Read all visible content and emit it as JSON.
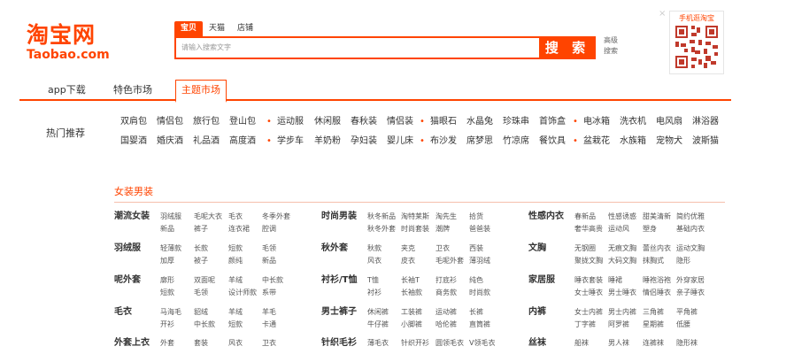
{
  "logo": {
    "cn": "淘宝网",
    "en": "Taobao.com"
  },
  "search": {
    "tabs": [
      "宝贝",
      "天猫",
      "店铺"
    ],
    "placeholder": "请输入搜索文字",
    "button": "搜 索",
    "advanced": [
      "高级",
      "搜索"
    ]
  },
  "qr": {
    "label": "手机逛淘宝",
    "close": "×"
  },
  "nav": {
    "items": [
      "app下载",
      "特色市场",
      "主题市场"
    ]
  },
  "hot": {
    "title": "热门推荐",
    "row1": [
      "双肩包",
      "情侣包",
      "旅行包",
      "登山包",
      "运动服",
      "休闲服",
      "春秋装",
      "情侣装",
      "猫眼石",
      "水晶兔",
      "珍珠串",
      "首饰盒",
      "电冰箱",
      "洗衣机",
      "电风扇",
      "淋浴器"
    ],
    "row2": [
      "国婴酒",
      "婚庆酒",
      "礼品酒",
      "高度酒",
      "学步车",
      "羊奶粉",
      "孕妇装",
      "婴儿床",
      "布沙发",
      "席梦思",
      "竹凉席",
      "餐饮具",
      "盆栽花",
      "水族箱",
      "宠物犬",
      "波斯猫"
    ]
  },
  "section": {
    "title": "女装男装",
    "columns": [
      [
        {
          "name": "潮流女装",
          "items": [
            "羽绒服",
            "毛呢大衣",
            "毛衣",
            "冬季外套",
            "新品",
            "裤子",
            "连衣裙",
            "腔调"
          ]
        },
        {
          "name": "羽绒服",
          "items": [
            "轻薄款",
            "长款",
            "短款",
            "毛领",
            "加厚",
            "被子",
            "颜纯",
            "新品"
          ]
        },
        {
          "name": "呢外套",
          "items": [
            "廓形",
            "双面呢",
            "羊绒",
            "中长款",
            "短款",
            "毛领",
            "设计师款",
            "系带"
          ]
        },
        {
          "name": "毛衣",
          "items": [
            "马海毛",
            "貂绒",
            "羊绒",
            "羊毛",
            "开衫",
            "中长款",
            "短款",
            "卡通"
          ]
        },
        {
          "name": "外套上衣",
          "items": [
            "外套",
            "套装",
            "风衣",
            "卫衣"
          ]
        }
      ],
      [
        {
          "name": "时尚男装",
          "items": [
            "秋冬新品",
            "淘特莱斯",
            "淘先生",
            "拾货",
            "秋冬外套",
            "时尚套装",
            "潮牌",
            "爸爸装"
          ]
        },
        {
          "name": "秋外套",
          "items": [
            "秋款",
            "夹克",
            "卫衣",
            "西装",
            "风衣",
            "皮衣",
            "毛呢外套",
            "薄羽绒"
          ]
        },
        {
          "name": "衬衫/T恤",
          "items": [
            "T恤",
            "长袖T",
            "打底衫",
            "纯色",
            "衬衫",
            "长袖款",
            "商务款",
            "时尚款"
          ]
        },
        {
          "name": "男士裤子",
          "items": [
            "休闲裤",
            "工装裤",
            "运动裤",
            "长裤",
            "牛仔裤",
            "小脚裤",
            "哈伦裤",
            "直筒裤"
          ]
        },
        {
          "name": "针织毛衫",
          "items": [
            "薄毛衣",
            "针织开衫",
            "圆领毛衣",
            "V领毛衣"
          ]
        }
      ],
      [
        {
          "name": "性感内衣",
          "items": [
            "春新品",
            "性感诱惑",
            "甜美清新",
            "简约优雅",
            "奢华高贵",
            "运动风",
            "塑身",
            "基础内衣"
          ]
        },
        {
          "name": "文胸",
          "items": [
            "无钢圈",
            "无痕文胸",
            "蕾丝内衣",
            "运动文胸",
            "聚拢文胸",
            "大码文胸",
            "抹胸式",
            "隐形"
          ]
        },
        {
          "name": "家居服",
          "items": [
            "睡衣套装",
            "睡裙",
            "睡袍浴袍",
            "外穿家居",
            "女士睡衣",
            "男士睡衣",
            "情侣睡衣",
            "亲子睡衣"
          ]
        },
        {
          "name": "内裤",
          "items": [
            "女士内裤",
            "男士内裤",
            "三角裤",
            "平角裤",
            "丁字裤",
            "阿罗裤",
            "星期裤",
            "低腰"
          ]
        },
        {
          "name": "丝袜",
          "items": [
            "船袜",
            "男人袜",
            "连裤袜",
            "隐形袜"
          ]
        }
      ]
    ]
  }
}
